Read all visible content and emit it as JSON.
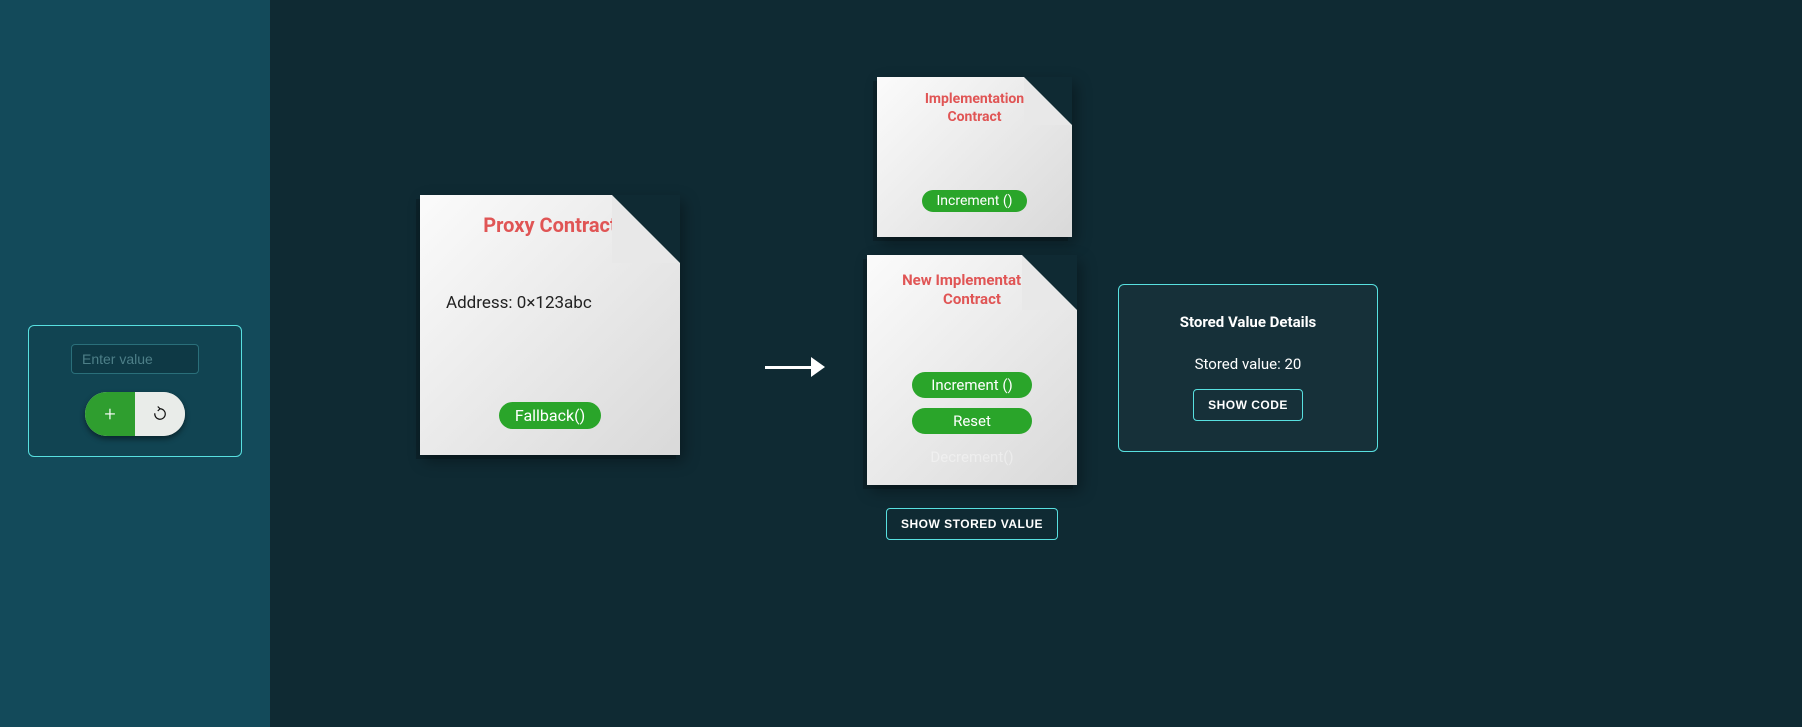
{
  "sidebar": {
    "input_placeholder": "Enter value"
  },
  "proxy": {
    "title": "Proxy Contract",
    "address_line": "Address: 0×123abc",
    "fallback_label": "Fallback()"
  },
  "impl_old": {
    "title": "Implementation\nContract",
    "increment_label": "Increment ()"
  },
  "impl_new": {
    "title": "New Implementation\nContract",
    "increment_label": "Increment ()",
    "reset_label": "Reset",
    "decrement_label": "Decrement()"
  },
  "details": {
    "header": "Stored Value Details",
    "value_line": "Stored value: 20",
    "show_code_btn": "Show Code"
  },
  "buttons": {
    "show_stored_value": "Show Stored Value"
  }
}
